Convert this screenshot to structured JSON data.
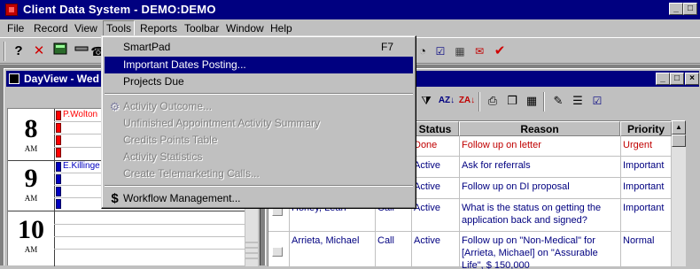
{
  "app": {
    "title": "Client Data System - DEMO:DEMO"
  },
  "window_controls": {
    "minimize": "_",
    "maximize": "□",
    "close": "×"
  },
  "menubar": [
    {
      "label": "File"
    },
    {
      "label": "Record"
    },
    {
      "label": "View"
    },
    {
      "label": "Tools"
    },
    {
      "label": "Reports"
    },
    {
      "label": "Toolbar"
    },
    {
      "label": "Window"
    },
    {
      "label": "Help"
    }
  ],
  "toolbar_icons": [
    "help-icon",
    "cancel-icon",
    "calculator-icon",
    "bar-icon",
    "phone-icon"
  ],
  "tools_menu": {
    "items": [
      {
        "label": "SmartPad",
        "shortcut": "F7",
        "enabled": true,
        "icon": ""
      },
      {
        "label": "Important Dates Posting...",
        "enabled": true,
        "selected": true
      },
      {
        "label": "Projects Due",
        "enabled": true
      },
      {
        "label": "Activity Outcome...",
        "enabled": false,
        "icon": "activity-icon"
      },
      {
        "label": "Unfinished Appointment Activity Summary",
        "enabled": false
      },
      {
        "label": "Credits Points Table",
        "enabled": false
      },
      {
        "label": "Activity Statistics",
        "enabled": false
      },
      {
        "label": "Create Telemarketing Calls...",
        "enabled": false
      },
      {
        "label": "Workflow Management...",
        "enabled": true,
        "icon": "dollar-icon"
      }
    ]
  },
  "dayview": {
    "title": "DayView - Wed",
    "hours": [
      {
        "num": "8",
        "ampm": "AM"
      },
      {
        "num": "9",
        "ampm": "AM"
      },
      {
        "num": "10",
        "ampm": "AM"
      }
    ],
    "appointments": [
      {
        "label": "P.Wolton",
        "color": "#ff0000"
      },
      {
        "label": "E.Killinge",
        "color": "#0000c0"
      }
    ]
  },
  "grid": {
    "columns": [
      "Status",
      "Reason",
      "Priority"
    ],
    "rows": [
      {
        "name": "",
        "type": "",
        "status": "Done",
        "reason": "Follow up on letter",
        "priority": "Urgent",
        "color": "#c00000"
      },
      {
        "name": "",
        "type": "",
        "status": "Active",
        "reason": "Ask for referrals",
        "priority": "Important",
        "color": "#000080"
      },
      {
        "name": "",
        "type": "",
        "status": "Active",
        "reason": "Follow up on DI proposal",
        "priority": "Important",
        "color": "#000080"
      },
      {
        "name": "Honey, Leah",
        "type": "Call",
        "status": "Active",
        "reason": "What is the status on getting the application back and signed?",
        "priority": "Important",
        "color": "#000080"
      },
      {
        "name": "Arrieta, Michael",
        "type": "Call",
        "status": "Active",
        "reason": "Follow up on \"Non-Medical\" for [Arrieta, Michael] on \"Assurable Life\", $ 150,000",
        "priority": "Normal",
        "color": "#000080"
      }
    ]
  }
}
